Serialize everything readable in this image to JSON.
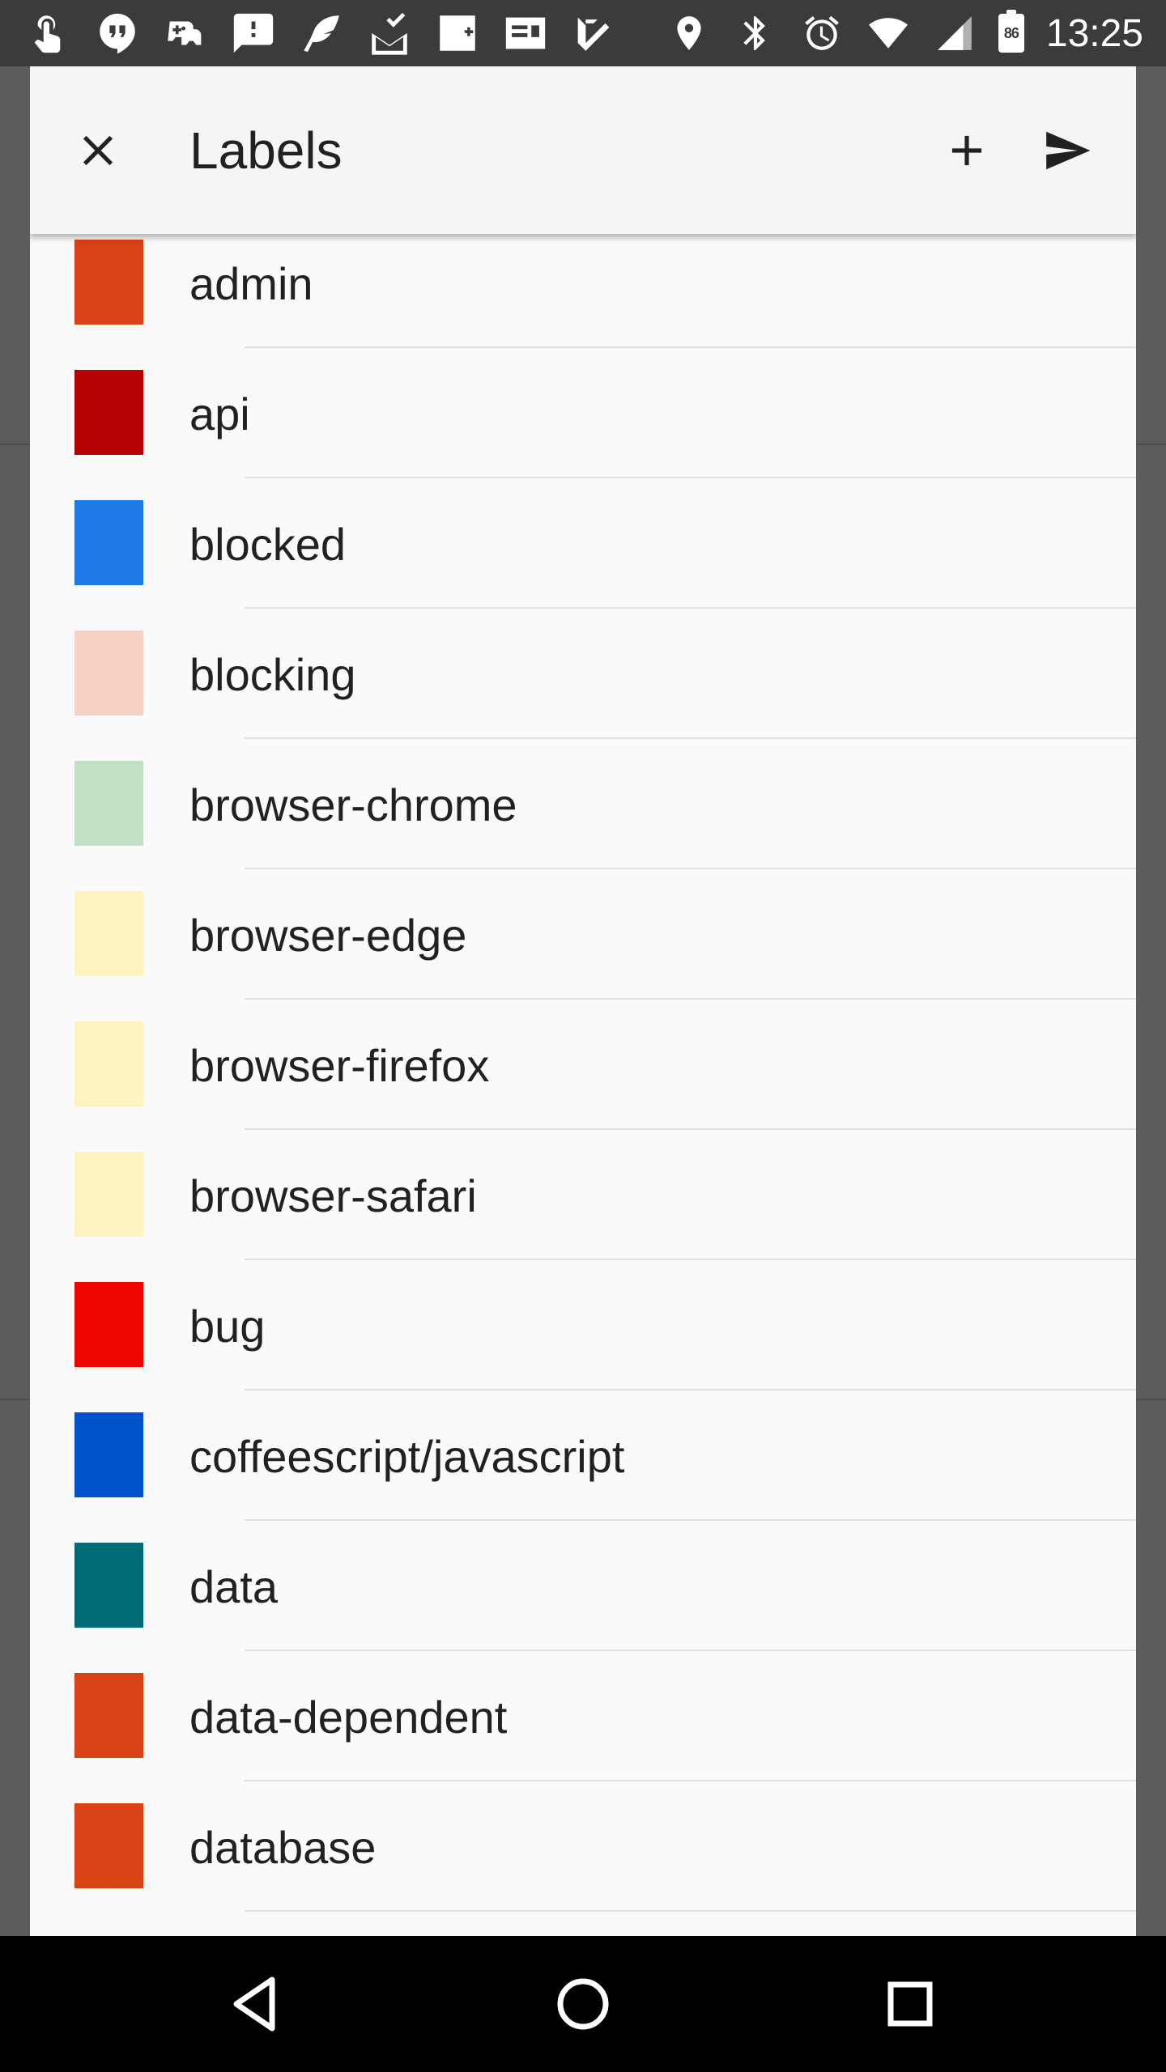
{
  "status_bar": {
    "time": "13:25",
    "battery_level": "86",
    "notification_icons": [
      "touch-icon",
      "hangouts-icon",
      "games-icon",
      "alert-message-icon",
      "feather-icon",
      "mail-check-icon",
      "google-plus-icon",
      "contact-card-icon",
      "task-check-icon"
    ],
    "system_icons": [
      "location-icon",
      "bluetooth-icon",
      "alarm-icon",
      "wifi-icon",
      "cell-signal-icon",
      "battery-icon"
    ]
  },
  "dialog": {
    "title": "Labels",
    "actions": [
      "close-icon",
      "add-icon",
      "send-icon"
    ]
  },
  "labels": [
    {
      "name": "admin",
      "color": "#D84315"
    },
    {
      "name": "api",
      "color": "#B60205"
    },
    {
      "name": "blocked",
      "color": "#1E7BE6"
    },
    {
      "name": "blocking",
      "color": "#F9D0C4"
    },
    {
      "name": "browser-chrome",
      "color": "#C2E0C6"
    },
    {
      "name": "browser-edge",
      "color": "#FEF2C0"
    },
    {
      "name": "browser-firefox",
      "color": "#FEF2C0"
    },
    {
      "name": "browser-safari",
      "color": "#FEF2C0"
    },
    {
      "name": "bug",
      "color": "#EE0701"
    },
    {
      "name": "coffeescript/javascript",
      "color": "#0052CC"
    },
    {
      "name": "data",
      "color": "#006B75"
    },
    {
      "name": "data-dependent",
      "color": "#D84315"
    },
    {
      "name": "database",
      "color": "#D84315"
    }
  ],
  "nav_bar": {
    "buttons": [
      "back-icon",
      "home-icon",
      "recents-icon"
    ]
  }
}
